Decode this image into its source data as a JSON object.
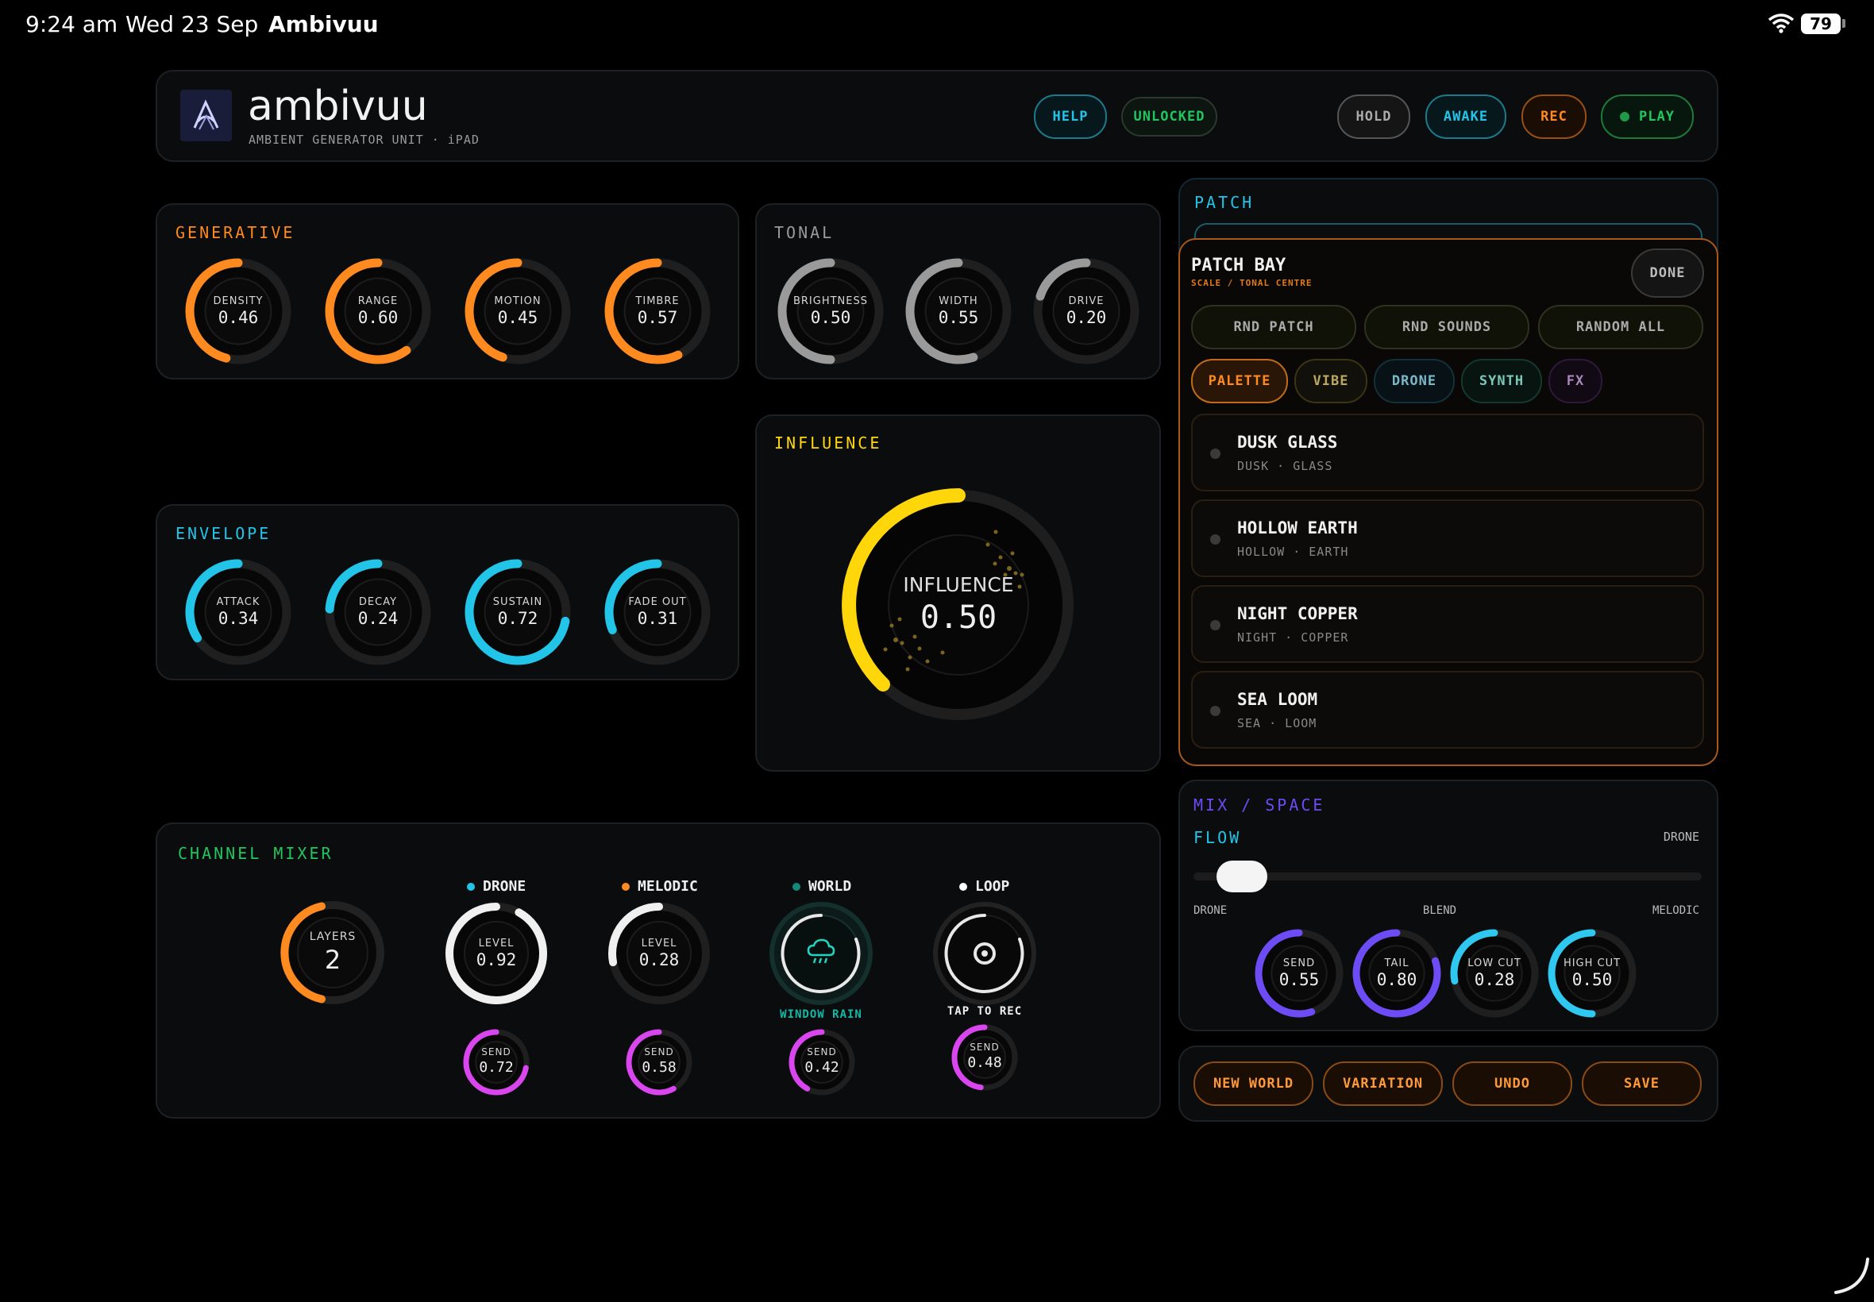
{
  "status_bar": {
    "time": "9:24 am",
    "date": "Wed 23 Sep",
    "app": "Ambivuu",
    "battery": "79"
  },
  "header": {
    "title": "ambivuu",
    "subtitle": "AMBIENT GENERATOR UNIT · iPAD",
    "help": "HELP",
    "unlocked": "UNLOCKED",
    "hold": "HOLD",
    "awake": "AWAKE",
    "rec": "REC",
    "play": "PLAY"
  },
  "generative": {
    "title": "GENERATIVE",
    "knobs": [
      {
        "label": "DENSITY",
        "value": "0.46"
      },
      {
        "label": "RANGE",
        "value": "0.60"
      },
      {
        "label": "MOTION",
        "value": "0.45"
      },
      {
        "label": "TIMBRE",
        "value": "0.57"
      }
    ]
  },
  "tonal": {
    "title": "TONAL",
    "knobs": [
      {
        "label": "BRIGHTNESS",
        "value": "0.50"
      },
      {
        "label": "WIDTH",
        "value": "0.55"
      },
      {
        "label": "DRIVE",
        "value": "0.20"
      }
    ]
  },
  "envelope": {
    "title": "ENVELOPE",
    "knobs": [
      {
        "label": "ATTACK",
        "value": "0.34"
      },
      {
        "label": "DECAY",
        "value": "0.24"
      },
      {
        "label": "SUSTAIN",
        "value": "0.72"
      },
      {
        "label": "FADE OUT",
        "value": "0.31"
      }
    ]
  },
  "influence": {
    "title": "INFLUENCE",
    "label": "INFLUENCE",
    "value": "0.50"
  },
  "patch": {
    "title": "PATCH"
  },
  "patch_bay": {
    "title": "PATCH BAY",
    "subtitle": "SCALE / TONAL CENTRE",
    "done": "DONE",
    "rnd_patch": "RND PATCH",
    "rnd_sounds": "RND SOUNDS",
    "random_all": "RANDOM ALL",
    "tabs": [
      "PALETTE",
      "VIBE",
      "DRONE",
      "SYNTH",
      "FX"
    ],
    "items": [
      {
        "title": "DUSK GLASS",
        "sub": "DUSK · GLASS"
      },
      {
        "title": "HOLLOW EARTH",
        "sub": "HOLLOW · EARTH"
      },
      {
        "title": "NIGHT COPPER",
        "sub": "NIGHT · COPPER"
      },
      {
        "title": "SEA LOOM",
        "sub": "SEA · LOOM"
      }
    ]
  },
  "mixer": {
    "title": "CHANNEL MIXER",
    "layers_label": "LAYERS",
    "layers_value": "2",
    "channels": [
      {
        "name": "DRONE",
        "level_label": "LEVEL",
        "level": "0.92",
        "send_label": "SEND",
        "send": "0.72",
        "color": "#22c5e8"
      },
      {
        "name": "MELODIC",
        "level_label": "LEVEL",
        "level": "0.28",
        "send_label": "SEND",
        "send": "0.58",
        "color": "#ff8a1f"
      },
      {
        "name": "WORLD",
        "caption": "WINDOW RAIN",
        "send_label": "SEND",
        "send": "0.42",
        "color": "#14897a"
      },
      {
        "name": "LOOP",
        "caption": "TAP TO REC",
        "send_label": "SEND",
        "send": "0.48",
        "color": "#ffffff"
      }
    ]
  },
  "mix_space": {
    "title": "MIX / SPACE",
    "flow": "FLOW",
    "flow_right": "DRONE",
    "left": "DRONE",
    "mid": "BLEND",
    "right": "MELODIC",
    "flow_value": 0.05,
    "knobs": [
      {
        "label": "SEND",
        "value": "0.55"
      },
      {
        "label": "TAIL",
        "value": "0.80"
      },
      {
        "label": "LOW CUT",
        "value": "0.28"
      },
      {
        "label": "HIGH CUT",
        "value": "0.50"
      }
    ]
  },
  "actions": {
    "new_world": "NEW WORLD",
    "variation": "VARIATION",
    "undo": "UNDO",
    "save": "SAVE"
  },
  "colors": {
    "orange": "#ff8a1f",
    "cyan": "#22c5e8",
    "yellow": "#ffd60a",
    "magenta": "#d946ef",
    "purple": "#6d4cf5",
    "green": "#22c55e",
    "grey": "#9a9a9a"
  }
}
